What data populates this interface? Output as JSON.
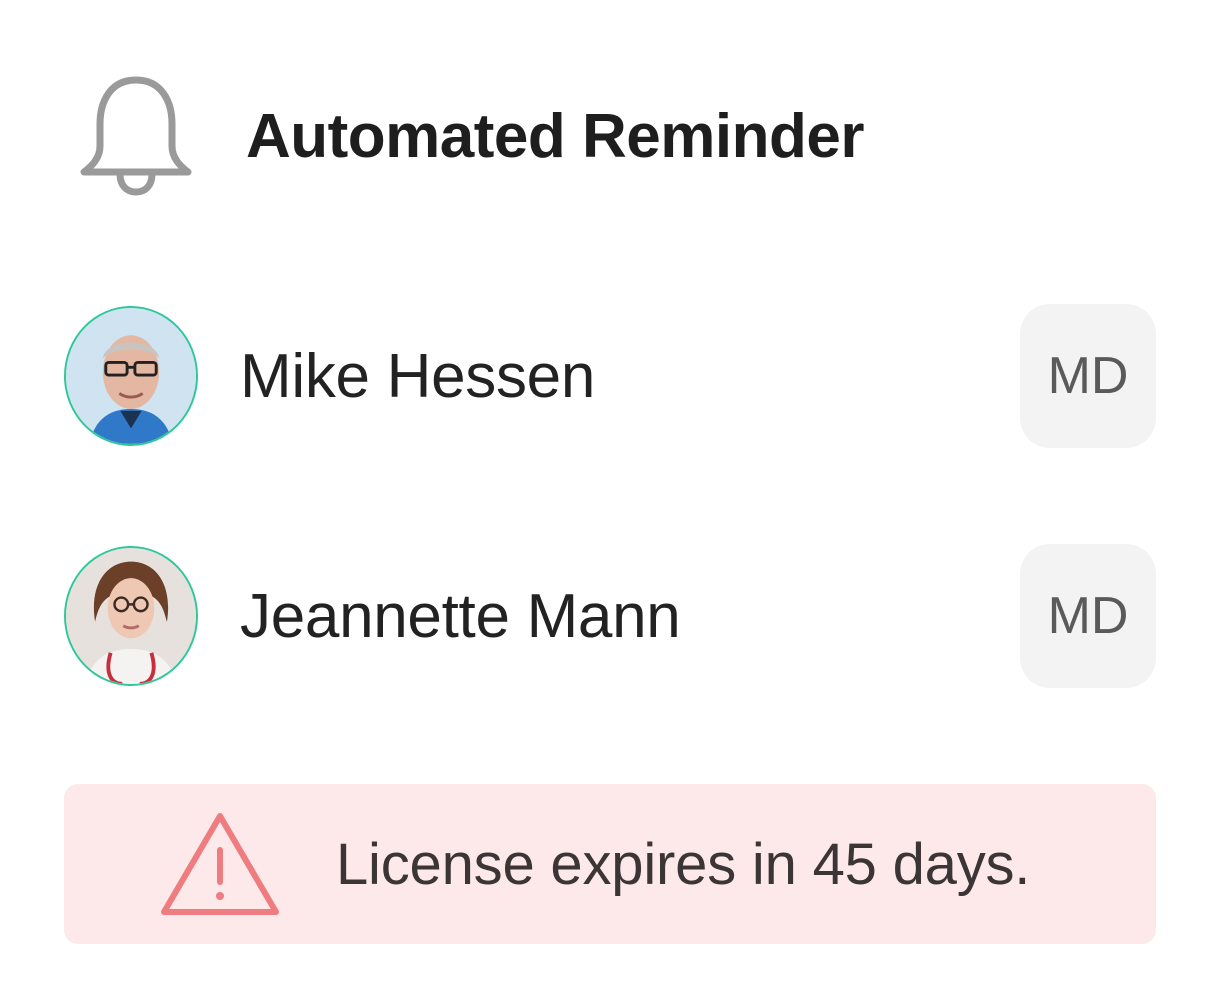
{
  "header": {
    "icon": "bell-icon",
    "title": "Automated Reminder"
  },
  "people": [
    {
      "name": "Mike Hessen",
      "credential": "MD",
      "avatar": "avatar-photo"
    },
    {
      "name": "Jeannette Mann",
      "credential": "MD",
      "avatar": "avatar-photo"
    }
  ],
  "alert": {
    "icon": "warning-triangle-icon",
    "message": "License expires in 45 days."
  },
  "colors": {
    "avatar_ring": "#2fc79a",
    "alert_bg": "#fde9ea",
    "alert_icon": "#ef7c7f",
    "badge_bg": "#f3f3f3",
    "bell_icon": "#9a9a9a"
  }
}
